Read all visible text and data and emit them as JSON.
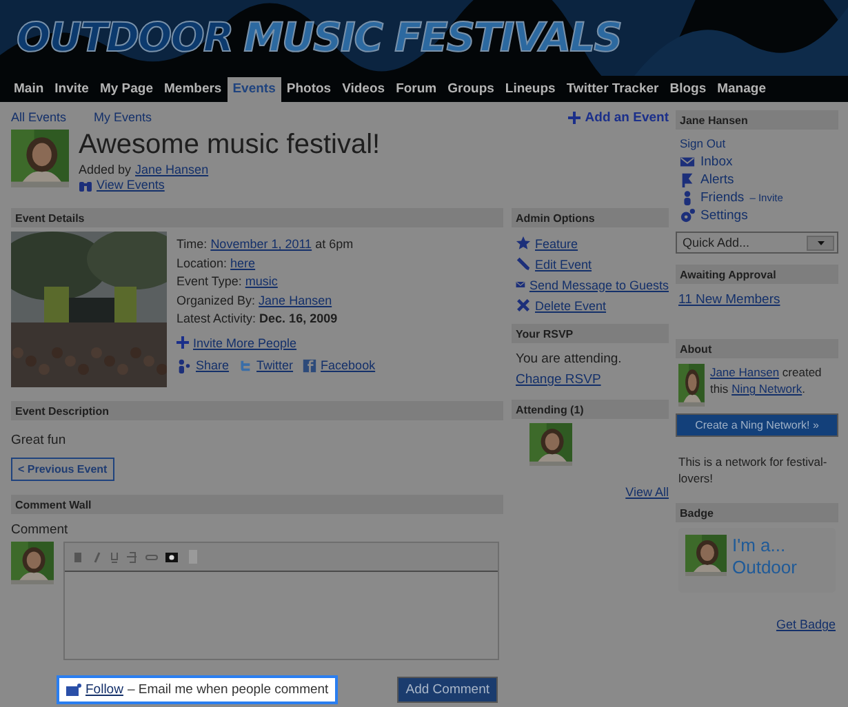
{
  "logo": [
    {
      "text": "OUTDOOR",
      "color": "#0c3a6e"
    },
    {
      "text": "MUSIC FESTIVALS",
      "color": "#2c69a0"
    }
  ],
  "nav": [
    {
      "label": "Main",
      "selected": false
    },
    {
      "label": "Invite",
      "selected": false
    },
    {
      "label": "My Page",
      "selected": false
    },
    {
      "label": "Members",
      "selected": false
    },
    {
      "label": "Events",
      "selected": true
    },
    {
      "label": "Photos",
      "selected": false
    },
    {
      "label": "Videos",
      "selected": false
    },
    {
      "label": "Forum",
      "selected": false
    },
    {
      "label": "Groups",
      "selected": false
    },
    {
      "label": "Lineups",
      "selected": false
    },
    {
      "label": "Twitter Tracker",
      "selected": false
    },
    {
      "label": "Blogs",
      "selected": false
    },
    {
      "label": "Manage",
      "selected": false
    }
  ],
  "subnav": [
    "All Events",
    "My Events"
  ],
  "add_event": "Add an Event",
  "event": {
    "title": "Awesome music festival!",
    "added_by_label": "Added by",
    "added_by": "Jane Hansen",
    "view_events": "View Events"
  },
  "details": {
    "header": "Event Details",
    "fields": [
      {
        "kind": "link",
        "label": "Time:",
        "value": "November 1, 2011",
        "suffix": "at 6pm"
      },
      {
        "kind": "link",
        "label": "Location:",
        "value": "here"
      },
      {
        "kind": "link",
        "label": "Event Type:",
        "value": "music"
      },
      {
        "kind": "link",
        "label": "Organized By:",
        "value": "Jane Hansen"
      },
      {
        "kind": "bold",
        "label": "Latest Activity:",
        "value": "Dec. 16, 2009"
      }
    ],
    "invite": "Invite More People",
    "share": [
      {
        "kind": "share",
        "label": "Share"
      },
      {
        "kind": "twitter",
        "label": "Twitter"
      },
      {
        "kind": "facebook",
        "label": "Facebook"
      }
    ]
  },
  "description": {
    "header": "Event Description",
    "text": "Great fun"
  },
  "previous_button": "< Previous Event",
  "comment_wall": {
    "header": "Comment Wall",
    "label": "Comment",
    "follow_link": "Follow",
    "follow_text": "– Email me when people comment",
    "highlighted": true,
    "submit": "Add Comment"
  },
  "admin": {
    "header": "Admin Options",
    "actions": [
      {
        "kind": "star",
        "label": "Feature"
      },
      {
        "kind": "edit",
        "label": "Edit Event"
      },
      {
        "kind": "mail",
        "label": "Send Message to Guests"
      },
      {
        "kind": "delete",
        "label": "Delete Event"
      }
    ]
  },
  "rsvp": {
    "header": "Your RSVP",
    "status": "You are attending.",
    "change": "Change RSVP"
  },
  "attending": {
    "header": "Attending (1)",
    "view_all": "View All"
  },
  "sidebar": {
    "user": "Jane Hansen",
    "sign_out": "Sign Out",
    "menu": [
      {
        "kind": "inbox",
        "label": "Inbox"
      },
      {
        "kind": "alerts",
        "label": "Alerts"
      },
      {
        "kind": "friends",
        "label": "Friends",
        "extra": "– Invite"
      },
      {
        "kind": "settings",
        "label": "Settings"
      }
    ],
    "quick_add": "Quick Add...",
    "approval_header": "Awaiting Approval",
    "approval_link": "11 New Members",
    "about_header": "About",
    "about_creator": "Jane Hansen",
    "about_created": "created this",
    "about_network": "Ning Network",
    "about_end": ".",
    "create_button": "Create a Ning Network! »",
    "about_text": "This is a network for festival-lovers!",
    "badge_header": "Badge",
    "badge_lines": [
      "I'm a...",
      "Outdoor"
    ],
    "get_badge": "Get Badge"
  }
}
